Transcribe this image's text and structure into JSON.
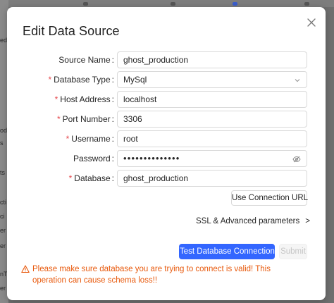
{
  "background": {
    "fragments": [
      "ed",
      "od",
      "s",
      "ts",
      "cti",
      "ci",
      "er",
      "er",
      "nT",
      "er"
    ]
  },
  "dialog": {
    "title": "Edit Data Source",
    "close_icon": "close-icon",
    "fields": [
      {
        "key": "source_name",
        "label": "Source Name",
        "required": false,
        "value": "ghost_production"
      },
      {
        "key": "database_type",
        "label": "Database Type",
        "required": true,
        "value": "MySql",
        "type": "select"
      },
      {
        "key": "host_address",
        "label": "Host Address",
        "required": true,
        "value": "localhost"
      },
      {
        "key": "port_number",
        "label": "Port Number",
        "required": true,
        "value": "3306"
      },
      {
        "key": "username",
        "label": "Username",
        "required": true,
        "value": "root"
      },
      {
        "key": "password",
        "label": "Password",
        "required": false,
        "value": "••••••••••••••",
        "type": "password"
      },
      {
        "key": "database",
        "label": "Database",
        "required": true,
        "value": "ghost_production"
      }
    ],
    "use_connection_url_label": "Use Connection URL",
    "ssl_label": "SSL & Advanced parameters",
    "ssl_arrow": ">",
    "test_connection_label": "Test Database Connection",
    "submit_label": "Submit",
    "warning_text": "Please make sure database you are trying to connect is valid! This operation can cause schema loss!!",
    "colors": {
      "primary": "#3366ff",
      "warning": "#e8590c",
      "required": "#e5484d"
    }
  }
}
